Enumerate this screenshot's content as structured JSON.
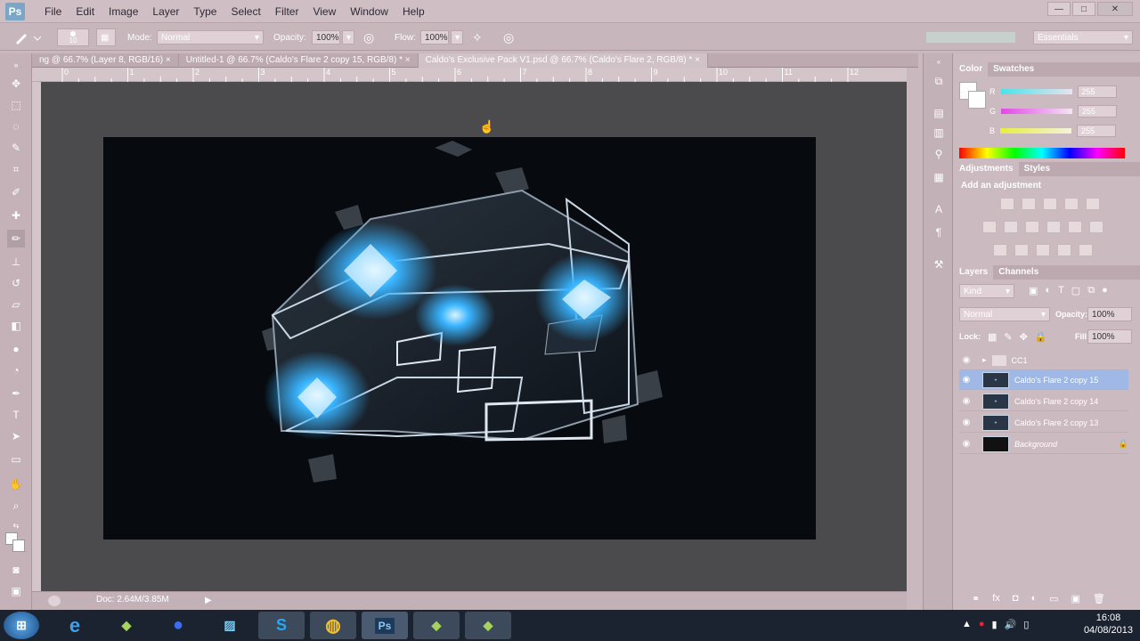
{
  "app": {
    "logo": "Ps"
  },
  "menu": [
    "File",
    "Edit",
    "Image",
    "Layer",
    "Type",
    "Select",
    "Filter",
    "View",
    "Window",
    "Help"
  ],
  "window_buttons": [
    "—",
    "□",
    "✕"
  ],
  "options": {
    "brush_size": "10",
    "mode_label": "Mode:",
    "mode_value": "Normal",
    "opacity_label": "Opacity:",
    "opacity_value": "100%",
    "flow_label": "Flow:",
    "flow_value": "100%",
    "workspace": "Essentials"
  },
  "tabs": [
    {
      "label": "ng @ 66.7% (Layer 8, RGB/16)",
      "close": "×"
    },
    {
      "label": "Untitled-1 @ 66.7% (Caldo's Flare 2 copy 15, RGB/8) *",
      "close": "×"
    },
    {
      "label": "Caldo's Exclusive Pack V1.psd @ 66.7% (Caldo's Flare 2, RGB/8) *",
      "close": "×"
    }
  ],
  "ruler_numbers": [
    "0",
    "1",
    "2",
    "3",
    "4",
    "5",
    "6",
    "7",
    "8",
    "9",
    "10",
    "11",
    "12"
  ],
  "status": {
    "doc": "Doc: 2.64M/3.85M"
  },
  "color_panel": {
    "tabs": [
      "Color",
      "Swatches"
    ],
    "channels": [
      {
        "label": "R",
        "value": "255"
      },
      {
        "label": "G",
        "value": "255"
      },
      {
        "label": "B",
        "value": "255"
      }
    ]
  },
  "adjustments_panel": {
    "tabs": [
      "Adjustments",
      "Styles"
    ],
    "title": "Add an adjustment"
  },
  "layers_panel": {
    "tabs": [
      "Layers",
      "Channels"
    ],
    "kind": "Kind",
    "blend": "Normal",
    "opacity_label": "Opacity:",
    "opacity_value": "100%",
    "lock_label": "Lock:",
    "fill_label": "Fill:",
    "fill_value": "100%",
    "layers": [
      {
        "name": "CC1",
        "type": "group"
      },
      {
        "name": "Caldo's Flare 2 copy 15",
        "type": "layer",
        "selected": true
      },
      {
        "name": "Caldo's Flare 2 copy 14",
        "type": "layer",
        "selected": false
      },
      {
        "name": "Caldo's Flare 2 copy 13",
        "type": "layer",
        "selected": false
      },
      {
        "name": "Background",
        "type": "background",
        "selected": false
      }
    ]
  },
  "taskbar": {
    "apps": [
      "start",
      "ie",
      "app-green",
      "app-blue",
      "app-notes",
      "skype",
      "chrome",
      "photoshop",
      "app-green-2",
      "app-green-3"
    ],
    "time": "16:08",
    "date": "04/08/2013"
  },
  "colors": {
    "accent": "#7aa7c7",
    "glow": "#2fa8ff",
    "selection": "#9fb8e6"
  }
}
